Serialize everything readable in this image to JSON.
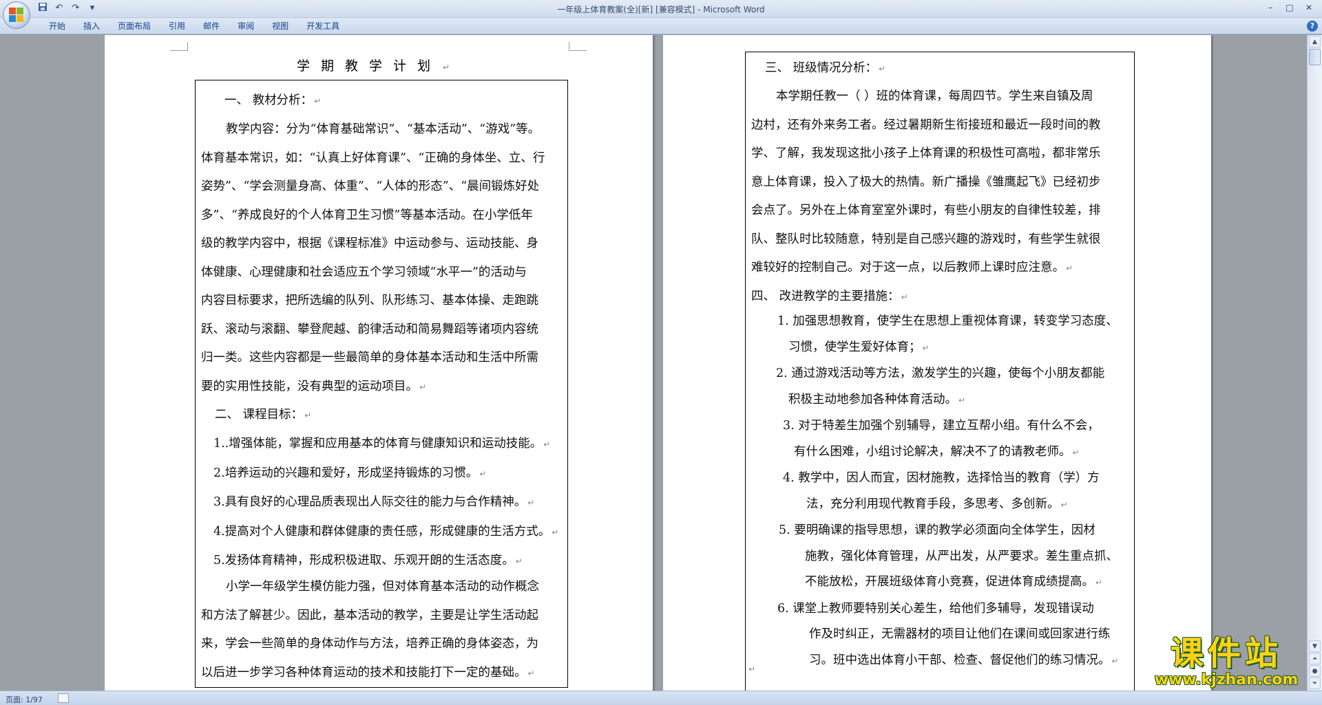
{
  "window": {
    "title": "一年级上体育教案(全)[新] [兼容模式] - Microsoft Word",
    "controls": [
      "–",
      "□",
      "✕"
    ]
  },
  "quick_access": {
    "save_icon": "save-icon",
    "undo_label": "↶",
    "redo_label": "↷",
    "customize_label": "▾"
  },
  "ribbon": {
    "tabs": [
      "开始",
      "插入",
      "页面布局",
      "引用",
      "邮件",
      "审阅",
      "视图",
      "开发工具"
    ],
    "help_label": "?"
  },
  "left_page": {
    "title": "学期教学计划",
    "section1_heading": "一、  教材分析：",
    "section1_lines": [
      "教学内容：分为“体育基础常识”、“基本活动”、“游戏”等。",
      "体育基本常识，如：“认真上好体育课”、“正确的身体坐、立、行",
      "姿势”、“学会测量身高、体重”、“人体的形态”、“晨间锻炼好处",
      "多”、“养成良好的个人体育卫生习惯”等基本活动。在小学低年",
      "级的教学内容中，根据《课程标准》中运动参与、运动技能、身",
      "体健康、心理健康和社会适应五个学习领域“水平一”的活动与",
      "内容目标要求，把所选编的队列、队形练习、基本体操、走跑跳",
      "跃、滚动与滚翻、攀登爬越、韵律活动和简易舞蹈等诸项内容统",
      "归一类。这些内容都是一些最简单的身体基本活动和生活中所需",
      "要的实用性技能，没有典型的运动项目。"
    ],
    "section2_heading": "二、  课程目标：",
    "goals": [
      "1..增强体能，掌握和应用基本的体育与健康知识和运动技能。",
      "2.培养运动的兴趣和爱好，形成坚持锻炼的习惯。",
      "3.具有良好的心理品质表现出人际交往的能力与合作精神。",
      "4.提高对个人健康和群体健康的责任感，形成健康的生活方式。",
      "5.发扬体育精神，形成积极进取、乐观开朗的生活态度。"
    ],
    "closing_lines": [
      "小学一年级学生模仿能力强，但对体育基本活动的动作概念",
      "和方法了解甚少。因此，基本活动的教学，主要是让学生活动起",
      "来，学会一些简单的身体动作与方法，培养正确的身体姿态，为",
      "以后进一步学习各种体育运动的技术和技能打下一定的基础。"
    ]
  },
  "right_page": {
    "section3_heading": "三、  班级情况分析：",
    "section3_lines": [
      "本学期任教一（    ）班的体育课，每周四节。学生来自镇及周",
      "边村，还有外来务工者。经过暑期新生衔接班和最近一段时间的教",
      "学、了解，我发现这批小孩子上体育课的积极性可高啦，都非常乐",
      "意上体育课，投入了极大的热情。新广播操《雏鹰起飞》已经初步",
      "会点了。另外在上体育室室外课时，有些小朋友的自律性较差，排",
      "队、整队时比较随意，特别是自己感兴趣的游戏时，有些学生就很",
      "难较好的控制自己。对于这一点，以后教师上课时应注意。"
    ],
    "section4_heading": "四、  改进教学的主要措施：",
    "measures": [
      [
        "1.   加强思想教育，使学生在思想上重视体育课，转变学习态度、",
        "习惯，使学生爱好体育；"
      ],
      [
        "2. 通过游戏活动等方法，激发学生的兴趣，使每个小朋友都能",
        "积极主动地参加各种体育活动。"
      ],
      [
        "3.   对于特差生加强个别辅导，建立互帮小组。有什么不会，",
        "有什么困难，小组讨论解决，解决不了的请教老师。"
      ],
      [
        "4.   教学中，因人而宜，因材施教，选择恰当的教育（学）方",
        "法，充分利用现代教育手段，多思考、多创新。"
      ],
      [
        "5.    要明确课的指导思想，课的教学必须面向全体学生，因材",
        "施教，强化体育管理，从严出发，从严要求。差生重点抓、",
        "不能放松，开展班级体育小竞赛，促进体育成绩提高。"
      ],
      [
        "6.    课堂上教师要特别关心差生，给他们多辅导，发现错误动",
        "作及时纠正，无需器材的项目让他们在课间或回家进行练",
        "习。班中选出体育小干部、检查、督促他们的练习情况。"
      ]
    ]
  },
  "paragraph_mark": "↵",
  "status": {
    "page_info": "页面: 1/97"
  },
  "watermark": {
    "text": "课件站",
    "url": "www.kjzhan.com"
  }
}
